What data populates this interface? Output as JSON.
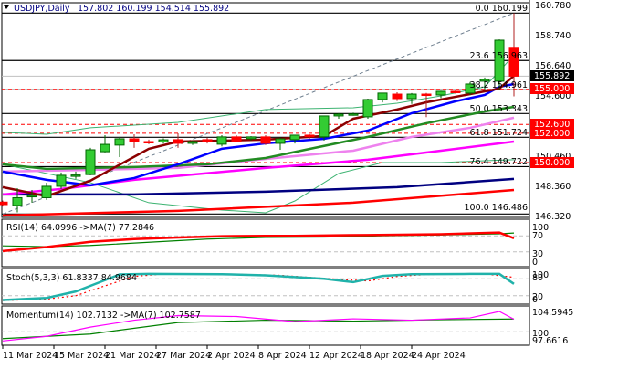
{
  "header": {
    "symbol": "USDJPY,Daily",
    "ohlc": "157.802 160.199 154.514 155.892"
  },
  "colors": {
    "bull": "#33cc33",
    "bear": "#ff0000",
    "wick_bull": "#006400",
    "wick_bear": "#b22222",
    "tag_red": "#ff0000",
    "tag_black": "#000000"
  },
  "chart_data": {
    "type": "candlestick",
    "title": "USDJPY,Daily",
    "ylim": [
      146.32,
      160.78
    ],
    "y_ticks": [
      "160.780",
      "158.740",
      "156.640",
      "154.600",
      "150.460",
      "148.360",
      "146.320"
    ],
    "x_ticks": [
      {
        "bar": 0,
        "label": "11 Mar 2024"
      },
      {
        "bar": 3.5,
        "label": "15 Mar 2024"
      },
      {
        "bar": 7,
        "label": "21 Mar 2024"
      },
      {
        "bar": 10.5,
        "label": "27 Mar 2024"
      },
      {
        "bar": 14,
        "label": "2 Apr 2024"
      },
      {
        "bar": 17.5,
        "label": "8 Apr 2024"
      },
      {
        "bar": 21,
        "label": "12 Apr 2024"
      },
      {
        "bar": 24.5,
        "label": "18 Apr 2024"
      },
      {
        "bar": 28,
        "label": "24 Apr 2024"
      }
    ],
    "candles": [
      [
        147.3,
        147.4,
        147.0,
        147.13
      ],
      [
        147.07,
        148.25,
        146.6,
        147.6
      ],
      [
        147.7,
        148.13,
        147.26,
        147.75
      ],
      [
        147.6,
        148.63,
        147.45,
        148.38
      ],
      [
        148.38,
        149.32,
        148.2,
        149.13
      ],
      [
        149.1,
        149.38,
        148.88,
        149.15
      ],
      [
        149.18,
        151.0,
        149.13,
        150.87
      ],
      [
        150.74,
        151.87,
        150.69,
        151.24
      ],
      [
        151.19,
        151.75,
        150.37,
        151.62
      ],
      [
        151.62,
        151.93,
        151.0,
        151.4
      ],
      [
        151.43,
        151.56,
        151.25,
        151.4
      ],
      [
        151.4,
        151.65,
        151.3,
        151.55
      ],
      [
        151.56,
        151.99,
        151.0,
        151.31
      ],
      [
        151.31,
        151.5,
        151.2,
        151.43
      ],
      [
        151.56,
        151.7,
        151.3,
        151.43
      ],
      [
        151.25,
        151.87,
        151.1,
        151.75
      ],
      [
        151.75,
        151.87,
        151.4,
        151.43
      ],
      [
        151.62,
        151.8,
        151.5,
        151.75
      ],
      [
        151.75,
        151.87,
        151.2,
        151.31
      ],
      [
        151.31,
        151.7,
        150.87,
        151.62
      ],
      [
        151.56,
        151.9,
        151.3,
        151.87
      ],
      [
        151.87,
        151.93,
        151.62,
        151.85
      ],
      [
        151.75,
        152.1,
        151.5,
        153.18
      ],
      [
        153.18,
        153.37,
        152.99,
        153.3
      ],
      [
        153.3,
        153.4,
        153.2,
        153.32
      ],
      [
        153.12,
        154.36,
        152.99,
        154.3
      ],
      [
        154.3,
        154.75,
        154.1,
        154.74
      ],
      [
        154.67,
        154.8,
        154.2,
        154.36
      ],
      [
        154.36,
        154.74,
        154.0,
        154.67
      ],
      [
        154.67,
        154.75,
        153.1,
        154.65
      ],
      [
        154.61,
        154.9,
        154.4,
        154.86
      ],
      [
        154.86,
        154.95,
        154.7,
        154.8
      ],
      [
        154.74,
        155.5,
        154.6,
        155.36
      ],
      [
        155.55,
        155.8,
        155.0,
        155.67
      ],
      [
        155.55,
        158.4,
        155.0,
        158.35
      ],
      [
        157.802,
        160.199,
        154.514,
        155.892
      ]
    ],
    "moving_averages": [
      {
        "name": "ma-maroon",
        "color": "#8b0000",
        "width": 2.5,
        "points": [
          [
            0,
            148.32
          ],
          [
            3,
            147.7
          ],
          [
            6,
            148.76
          ],
          [
            10,
            150.94
          ],
          [
            12,
            151.43
          ],
          [
            18,
            151.56
          ],
          [
            22,
            151.81
          ],
          [
            24,
            152.99
          ],
          [
            27,
            153.62
          ],
          [
            29,
            154.11
          ],
          [
            33,
            154.86
          ],
          [
            34,
            155.05
          ],
          [
            35,
            155.92
          ]
        ]
      },
      {
        "name": "ma-blue",
        "color": "#0000ff",
        "width": 2.5,
        "points": [
          [
            0,
            149.38
          ],
          [
            3,
            148.82
          ],
          [
            6,
            148.45
          ],
          [
            9,
            148.94
          ],
          [
            12,
            149.88
          ],
          [
            15,
            150.94
          ],
          [
            18,
            151.31
          ],
          [
            22,
            151.62
          ],
          [
            25,
            152.18
          ],
          [
            28,
            153.37
          ],
          [
            31,
            154.18
          ],
          [
            33,
            154.61
          ],
          [
            34,
            155.17
          ],
          [
            35,
            155.36
          ]
        ]
      },
      {
        "name": "ma-green",
        "color": "#228b22",
        "width": 2.5,
        "points": [
          [
            0,
            149.88
          ],
          [
            3,
            149.57
          ],
          [
            9,
            149.69
          ],
          [
            14,
            149.88
          ],
          [
            18,
            150.31
          ],
          [
            25,
            151.75
          ],
          [
            29,
            152.68
          ],
          [
            33,
            153.49
          ],
          [
            35,
            153.8
          ]
        ]
      },
      {
        "name": "ma-violet",
        "color": "#ee82ee",
        "width": 2.5,
        "points": [
          [
            0,
            149.38
          ],
          [
            6,
            149.5
          ],
          [
            12,
            149.63
          ],
          [
            18,
            150.25
          ],
          [
            24,
            150.81
          ],
          [
            28,
            151.75
          ],
          [
            32,
            152.37
          ],
          [
            35,
            153.06
          ]
        ]
      },
      {
        "name": "ma-magenta",
        "color": "#ff00ff",
        "width": 2.5,
        "points": [
          [
            0,
            147.82
          ],
          [
            4,
            148.2
          ],
          [
            9,
            148.82
          ],
          [
            18,
            149.63
          ],
          [
            25,
            150.19
          ],
          [
            30,
            150.81
          ],
          [
            35,
            151.43
          ]
        ]
      },
      {
        "name": "ma-navy",
        "color": "#000080",
        "width": 2.5,
        "points": [
          [
            0,
            147.82
          ],
          [
            9,
            147.82
          ],
          [
            18,
            148.01
          ],
          [
            27,
            148.32
          ],
          [
            35,
            148.88
          ]
        ]
      },
      {
        "name": "ma-red",
        "color": "#ff0000",
        "width": 2.5,
        "points": [
          [
            0,
            146.39
          ],
          [
            12,
            146.7
          ],
          [
            24,
            147.26
          ],
          [
            35,
            148.13
          ]
        ]
      },
      {
        "name": "bollinger-upper",
        "color": "#3cb371",
        "width": 1,
        "points": [
          [
            0,
            152.06
          ],
          [
            3,
            151.93
          ],
          [
            6,
            152.37
          ],
          [
            12,
            152.74
          ],
          [
            18,
            153.62
          ],
          [
            24,
            153.74
          ],
          [
            27,
            154.05
          ],
          [
            30,
            154.55
          ],
          [
            33,
            155.17
          ],
          [
            34,
            156.23
          ],
          [
            35,
            157.35
          ]
        ]
      },
      {
        "name": "bollinger-lower",
        "color": "#3cb371",
        "width": 1,
        "points": [
          [
            0,
            149.88
          ],
          [
            6,
            148.63
          ],
          [
            10,
            147.26
          ],
          [
            15,
            146.76
          ],
          [
            18,
            146.57
          ],
          [
            20,
            147.38
          ],
          [
            23,
            149.25
          ],
          [
            26,
            150.0
          ],
          [
            30,
            150.0
          ],
          [
            33,
            150.12
          ],
          [
            35,
            150.19
          ]
        ]
      }
    ],
    "trendline": {
      "from": [
        0,
        146.486
      ],
      "to": [
        35,
        160.199
      ]
    },
    "fibonacci": [
      {
        "level": "0.0",
        "price": 160.199,
        "label": "0.0 160.199"
      },
      {
        "level": "23.6",
        "price": 156.963,
        "label": "23.6 156.963"
      },
      {
        "level": "38.2",
        "price": 154.961,
        "label": "38.2 154.961"
      },
      {
        "level": "50.0",
        "price": 153.343,
        "label": "50.0 153.343"
      },
      {
        "level": "61.8",
        "price": 151.724,
        "label": "61.8 151.724"
      },
      {
        "level": "76.4",
        "price": 149.722,
        "label": "76.4 149.722"
      },
      {
        "level": "100.0",
        "price": 146.486,
        "label": "100.0 146.486"
      }
    ],
    "horizontal_levels": [
      {
        "price": 155.0,
        "label": "155.000"
      },
      {
        "price": 152.6,
        "label": "152.600"
      },
      {
        "price": 152.0,
        "label": "152.000"
      },
      {
        "price": 150.0,
        "label": "150.000"
      }
    ],
    "current_price": {
      "price": 155.892,
      "label": "155.892"
    },
    "rsi": {
      "label": "RSI(14) 64.0996  ->MA(7) 77.2846",
      "ylim": [
        0,
        100
      ],
      "levels": [
        70,
        30
      ],
      "ticks": [
        "100",
        "70",
        "30",
        "0"
      ],
      "rsi": [
        [
          0,
          32
        ],
        [
          3,
          42
        ],
        [
          6,
          55
        ],
        [
          9,
          62
        ],
        [
          12,
          66
        ],
        [
          15,
          69
        ],
        [
          18,
          70
        ],
        [
          20,
          70
        ],
        [
          25,
          72
        ],
        [
          30,
          74
        ],
        [
          34,
          78
        ],
        [
          35,
          64
        ]
      ],
      "ma": [
        [
          0,
          45
        ],
        [
          3,
          43
        ],
        [
          6,
          46
        ],
        [
          10,
          54
        ],
        [
          14,
          62
        ],
        [
          18,
          66
        ],
        [
          22,
          67
        ],
        [
          26,
          70
        ],
        [
          30,
          72
        ],
        [
          34,
          75
        ],
        [
          35,
          77
        ]
      ]
    },
    "stoch": {
      "label": "Stoch(5,3,3) 61.8337 84.9684",
      "ylim": [
        0,
        100
      ],
      "levels": [
        80,
        20
      ],
      "ticks": [
        "100",
        "80",
        "20",
        "0"
      ],
      "main": [
        [
          0,
          5
        ],
        [
          3,
          12
        ],
        [
          5,
          35
        ],
        [
          7,
          75
        ],
        [
          8,
          95
        ],
        [
          10,
          97
        ],
        [
          15,
          96
        ],
        [
          18,
          92
        ],
        [
          22,
          80
        ],
        [
          24,
          68
        ],
        [
          26,
          90
        ],
        [
          28,
          96
        ],
        [
          32,
          97
        ],
        [
          34,
          97
        ],
        [
          35,
          62
        ]
      ],
      "signal": [
        [
          0,
          3
        ],
        [
          3,
          8
        ],
        [
          5,
          20
        ],
        [
          7,
          55
        ],
        [
          9,
          88
        ],
        [
          11,
          97
        ],
        [
          16,
          96
        ],
        [
          19,
          92
        ],
        [
          23,
          78
        ],
        [
          25,
          72
        ],
        [
          27,
          88
        ],
        [
          29,
          95
        ],
        [
          33,
          97
        ],
        [
          35,
          85
        ]
      ]
    },
    "momentum": {
      "label": "Momentum(14) 102.7132  ->MA(7) 102.7587",
      "ylim": [
        97.6616,
        104.5945
      ],
      "levels": [
        100
      ],
      "ticks": [
        "104.5945",
        "100",
        "97.6616"
      ],
      "momentum": [
        [
          0,
          98
        ],
        [
          3,
          99
        ],
        [
          6,
          101
        ],
        [
          9,
          102.5
        ],
        [
          12,
          103.5
        ],
        [
          16,
          103.3
        ],
        [
          20,
          102.2
        ],
        [
          24,
          102.8
        ],
        [
          28,
          102.5
        ],
        [
          32,
          103
        ],
        [
          34,
          104.4
        ],
        [
          35,
          102.71
        ]
      ],
      "ma": [
        [
          0,
          98.5
        ],
        [
          6,
          99.5
        ],
        [
          12,
          102
        ],
        [
          18,
          102.5
        ],
        [
          24,
          102.3
        ],
        [
          30,
          102.6
        ],
        [
          35,
          102.76
        ]
      ]
    }
  }
}
